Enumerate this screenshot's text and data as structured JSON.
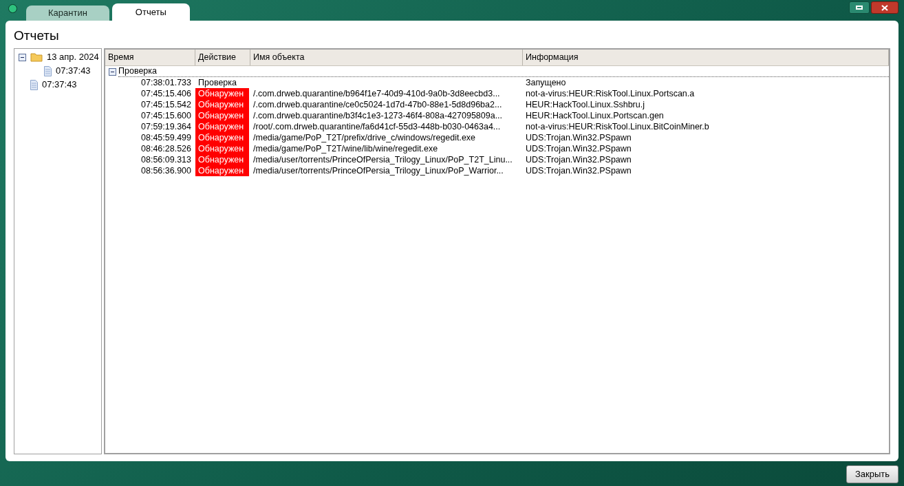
{
  "tabs": [
    {
      "label": "Карантин",
      "selected": false
    },
    {
      "label": "Отчеты",
      "selected": true
    }
  ],
  "page_title": "Отчеты",
  "tree": [
    {
      "label": "13 апр. 2024",
      "kind": "folder",
      "expanded": true,
      "children": [
        {
          "label": "07:37:43",
          "kind": "file"
        }
      ]
    },
    {
      "label": "07:37:43",
      "kind": "file"
    }
  ],
  "table": {
    "columns": [
      "Время",
      "Действие",
      "Имя объекта",
      "Информация"
    ],
    "groups": [
      {
        "label": "Проверка",
        "expanded": true,
        "rows": [
          {
            "time": "07:38:01.733",
            "action": "Проверка",
            "kind": "status",
            "object": "",
            "info": "Запущено"
          },
          {
            "time": "07:45:15.406",
            "action": "Обнаружен",
            "kind": "detected",
            "object": "/.com.drweb.quarantine/b964f1e7-40d9-410d-9a0b-3d8eecbd3...",
            "info": "not-a-virus:HEUR:RiskTool.Linux.Portscan.a"
          },
          {
            "time": "07:45:15.542",
            "action": "Обнаружен",
            "kind": "detected",
            "object": "/.com.drweb.quarantine/ce0c5024-1d7d-47b0-88e1-5d8d96ba2...",
            "info": "HEUR:HackTool.Linux.Sshbru.j"
          },
          {
            "time": "07:45:15.600",
            "action": "Обнаружен",
            "kind": "detected",
            "object": "/.com.drweb.quarantine/b3f4c1e3-1273-46f4-808a-427095809a...",
            "info": "HEUR:HackTool.Linux.Portscan.gen"
          },
          {
            "time": "07:59:19.364",
            "action": "Обнаружен",
            "kind": "detected",
            "object": "/root/.com.drweb.quarantine/fa6d41cf-55d3-448b-b030-0463a4...",
            "info": "not-a-virus:HEUR:RiskTool.Linux.BitCoinMiner.b"
          },
          {
            "time": "08:45:59.499",
            "action": "Обнаружен",
            "kind": "detected",
            "object": "/media/game/PoP_T2T/prefix/drive_c/windows/regedit.exe",
            "info": "UDS:Trojan.Win32.PSpawn"
          },
          {
            "time": "08:46:28.526",
            "action": "Обнаружен",
            "kind": "detected",
            "object": "/media/game/PoP_T2T/wine/lib/wine/regedit.exe",
            "info": "UDS:Trojan.Win32.PSpawn"
          },
          {
            "time": "08:56:09.313",
            "action": "Обнаружен",
            "kind": "detected",
            "object": "/media/user/torrents/PrinceOfPersia_Trilogy_Linux/PoP_T2T_Linu...",
            "info": "UDS:Trojan.Win32.PSpawn"
          },
          {
            "time": "08:56:36.900",
            "action": "Обнаружен",
            "kind": "detected",
            "object": "/media/user/torrents/PrinceOfPersia_Trilogy_Linux/PoP_Warrior...",
            "info": "UDS:Trojan.Win32.PSpawn"
          }
        ]
      }
    ]
  },
  "close_button": "Закрыть"
}
